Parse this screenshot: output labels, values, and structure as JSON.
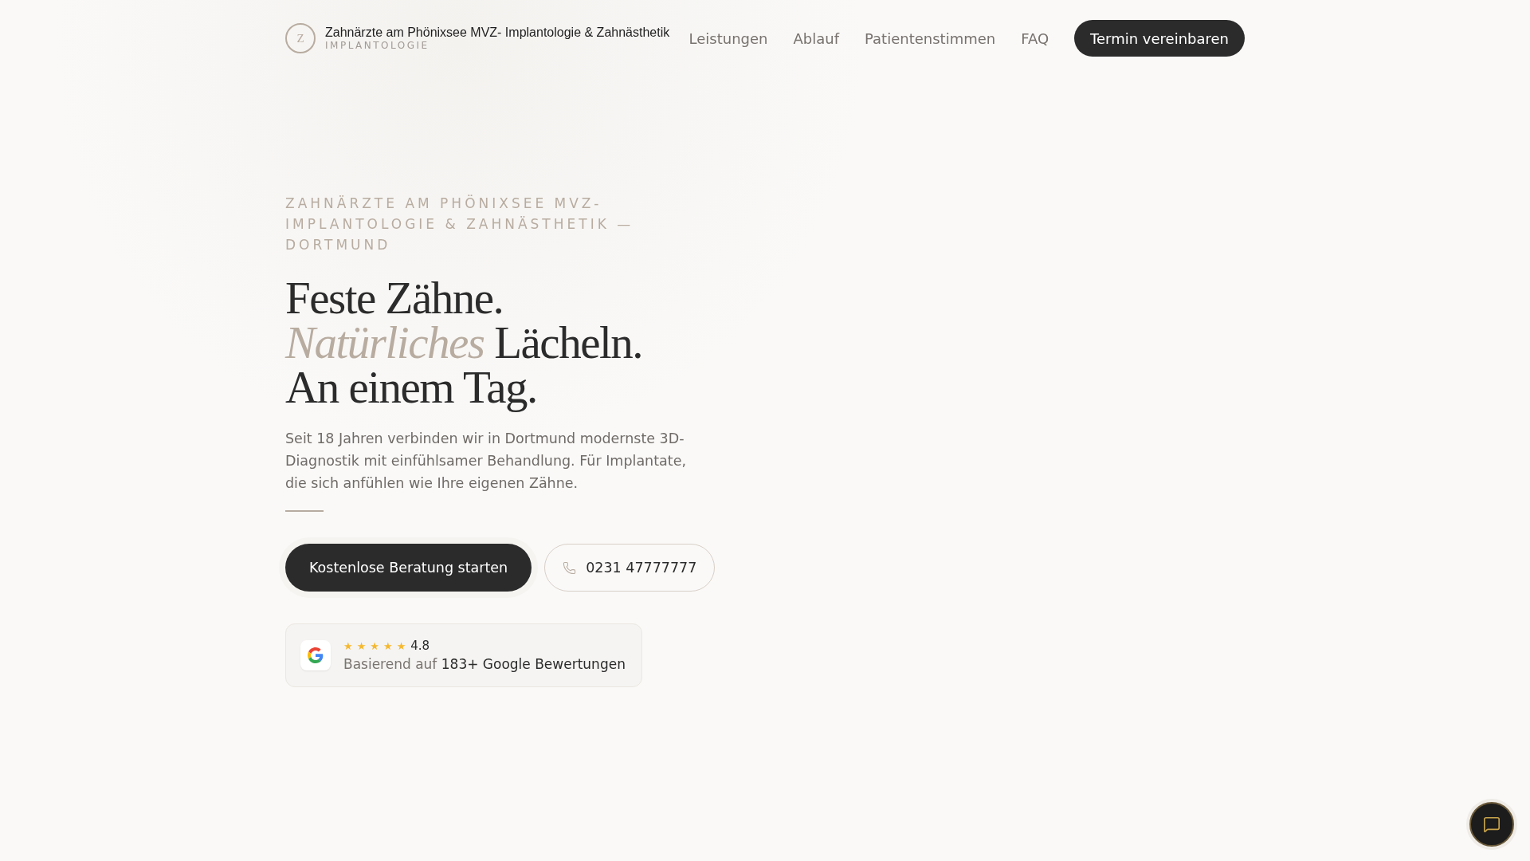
{
  "header": {
    "logo_letter": "Z",
    "brand": "Zahnärzte am Phönixsee MVZ- Implantologie & Zahnästhetik",
    "tagline": "IMPLANTOLOGIE",
    "nav": [
      {
        "label": "Leistungen"
      },
      {
        "label": "Ablauf"
      },
      {
        "label": "Patientenstimmen"
      },
      {
        "label": "FAQ"
      }
    ],
    "cta": "Termin vereinbaren"
  },
  "hero": {
    "eyebrow": "ZAHNÄRZTE AM PHÖNIXSEE MVZ- IMPLANTOLOGIE & ZAHNÄSTHETIK — DORTMUND",
    "headline": [
      "Feste Zähne.",
      "*Natürliches* Lächeln.",
      "An einem Tag."
    ],
    "text": "Seit 18 Jahren verbinden wir in Dortmund modernste 3D-Diagnostik mit einfühlsamer Behandlung. Für Implantate, die sich anfühlen wie Ihre eigenen Zähne.",
    "primary_button": "Kostenlose Beratung starten",
    "phone_button": "0231 47777777",
    "rating": {
      "stars": 5,
      "score": "4.8",
      "text": "Basierend auf **183+ Google Bewertungen**"
    }
  }
}
